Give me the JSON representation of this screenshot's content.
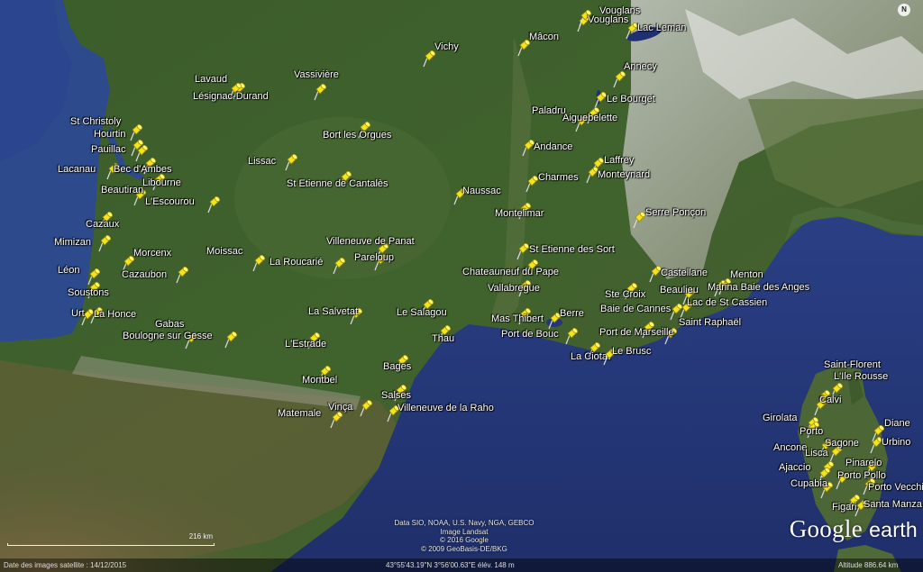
{
  "app": {
    "name": "Google Earth",
    "logo_word_1": "Google",
    "logo_word_2": "earth"
  },
  "credits": [
    "Data SIO, NOAA, U.S. Navy, NGA, GEBCO",
    "Image Landsat",
    "© 2016 Google",
    "© 2009 GeoBasis-DE/BKG"
  ],
  "scale": {
    "label": "216 km"
  },
  "status_bar": {
    "imagery_date": "Date des images satellite : 14/12/2015",
    "coordinates": "43°55'43.19\"N    3°56'00.63\"E  élév.   148 m",
    "altitude": "Altitude   886.64 km"
  },
  "compass": {
    "label": "N"
  },
  "placemarks": [
    {
      "name": "Vouglans"
    },
    {
      "name": "Vouglans"
    },
    {
      "name": "Mâcon"
    },
    {
      "name": "Lac Leman"
    },
    {
      "name": "Vichy"
    },
    {
      "name": "Annecy"
    },
    {
      "name": "Lavaud"
    },
    {
      "name": "Vassivière"
    },
    {
      "name": "Lésignac-Durand"
    },
    {
      "name": "Le Bourget"
    },
    {
      "name": "Paladru"
    },
    {
      "name": "Aiguebelette"
    },
    {
      "name": "St Christoly"
    },
    {
      "name": "Hourtin"
    },
    {
      "name": "Bort les Orgues"
    },
    {
      "name": "Pauillac"
    },
    {
      "name": "Andance"
    },
    {
      "name": "Lissac"
    },
    {
      "name": "Laffrey"
    },
    {
      "name": "Lacanau"
    },
    {
      "name": "Bec d'Ambes"
    },
    {
      "name": "Monteynard"
    },
    {
      "name": "Libourne"
    },
    {
      "name": "Charmes"
    },
    {
      "name": "St Etienne de Cantalès"
    },
    {
      "name": "Beautiran"
    },
    {
      "name": "Naussac"
    },
    {
      "name": "L'Escourou"
    },
    {
      "name": "Montelimar"
    },
    {
      "name": "Cazaux"
    },
    {
      "name": "Serre Ponçon"
    },
    {
      "name": "Mimizan"
    },
    {
      "name": "Villeneuve de Panat"
    },
    {
      "name": "St Etienne des Sort"
    },
    {
      "name": "Morcenx"
    },
    {
      "name": "Moissac"
    },
    {
      "name": "Pareloup"
    },
    {
      "name": "La Roucarié"
    },
    {
      "name": "Chateauneuf du Pape"
    },
    {
      "name": "Castellane"
    },
    {
      "name": "Menton"
    },
    {
      "name": "Léon"
    },
    {
      "name": "Cazaubon"
    },
    {
      "name": "Vallabregue"
    },
    {
      "name": "Ste Croix"
    },
    {
      "name": "Marina Baie des Anges"
    },
    {
      "name": "Soustons"
    },
    {
      "name": "Beaulieu"
    },
    {
      "name": "Lac de St Cassien"
    },
    {
      "name": "Urt"
    },
    {
      "name": "La Honce"
    },
    {
      "name": "La Salvetat"
    },
    {
      "name": "Le Salagou"
    },
    {
      "name": "Baie de Cannes"
    },
    {
      "name": "Berre"
    },
    {
      "name": "Mas Thibert"
    },
    {
      "name": "Gabas"
    },
    {
      "name": "Saint Raphaël"
    },
    {
      "name": "Thau"
    },
    {
      "name": "Port de Bouc"
    },
    {
      "name": "Port de Marseille"
    },
    {
      "name": "Boulogne sur Gesse"
    },
    {
      "name": "L'Estrade"
    },
    {
      "name": "La Ciotat"
    },
    {
      "name": "Le Brusc"
    },
    {
      "name": "Bages"
    },
    {
      "name": "Saint-Florent"
    },
    {
      "name": "L'Ile Rousse"
    },
    {
      "name": "Montbel"
    },
    {
      "name": "Calvi"
    },
    {
      "name": "Salses"
    },
    {
      "name": "Villeneuve de la Raho"
    },
    {
      "name": "Vinça"
    },
    {
      "name": "Matemale"
    },
    {
      "name": "Girolata"
    },
    {
      "name": "Diane"
    },
    {
      "name": "Porto"
    },
    {
      "name": "Urbino"
    },
    {
      "name": "Ancone"
    },
    {
      "name": "Sagone"
    },
    {
      "name": "Lisca"
    },
    {
      "name": "Pinarelo"
    },
    {
      "name": "Ajaccio"
    },
    {
      "name": "Porto Pollo"
    },
    {
      "name": "Cupabia"
    },
    {
      "name": "Porto Vecchio"
    },
    {
      "name": "Figari"
    },
    {
      "name": "Santa Manza"
    }
  ]
}
